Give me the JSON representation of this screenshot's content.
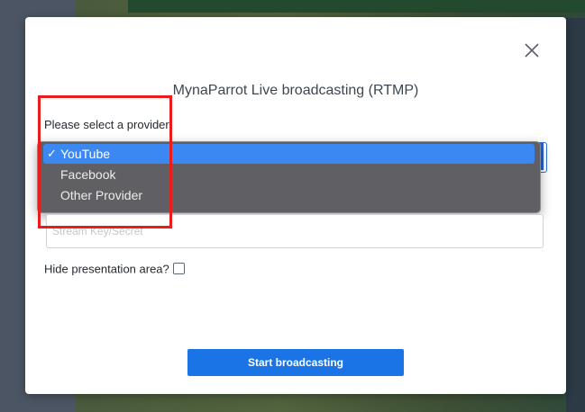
{
  "modal": {
    "title": "MynaParrot Live broadcasting (RTMP)",
    "provider_label": "Please select a provider",
    "provider_select": {
      "selected": "YouTube",
      "check_glyph": "✓",
      "options": [
        "YouTube",
        "Facebook",
        "Other Provider"
      ]
    },
    "stream_key": {
      "placeholder": "Stream Key/Secret",
      "value": ""
    },
    "hide_presentation": {
      "label": "Hide presentation area?",
      "checked": false
    },
    "start_button_label": "Start broadcasting",
    "close_icon": "close-icon"
  },
  "colors": {
    "accent": "#1a74e6",
    "highlight": "#ea1c1c",
    "dropdown_selected": "#3c88f2",
    "dropdown_bg": "#605f63"
  }
}
